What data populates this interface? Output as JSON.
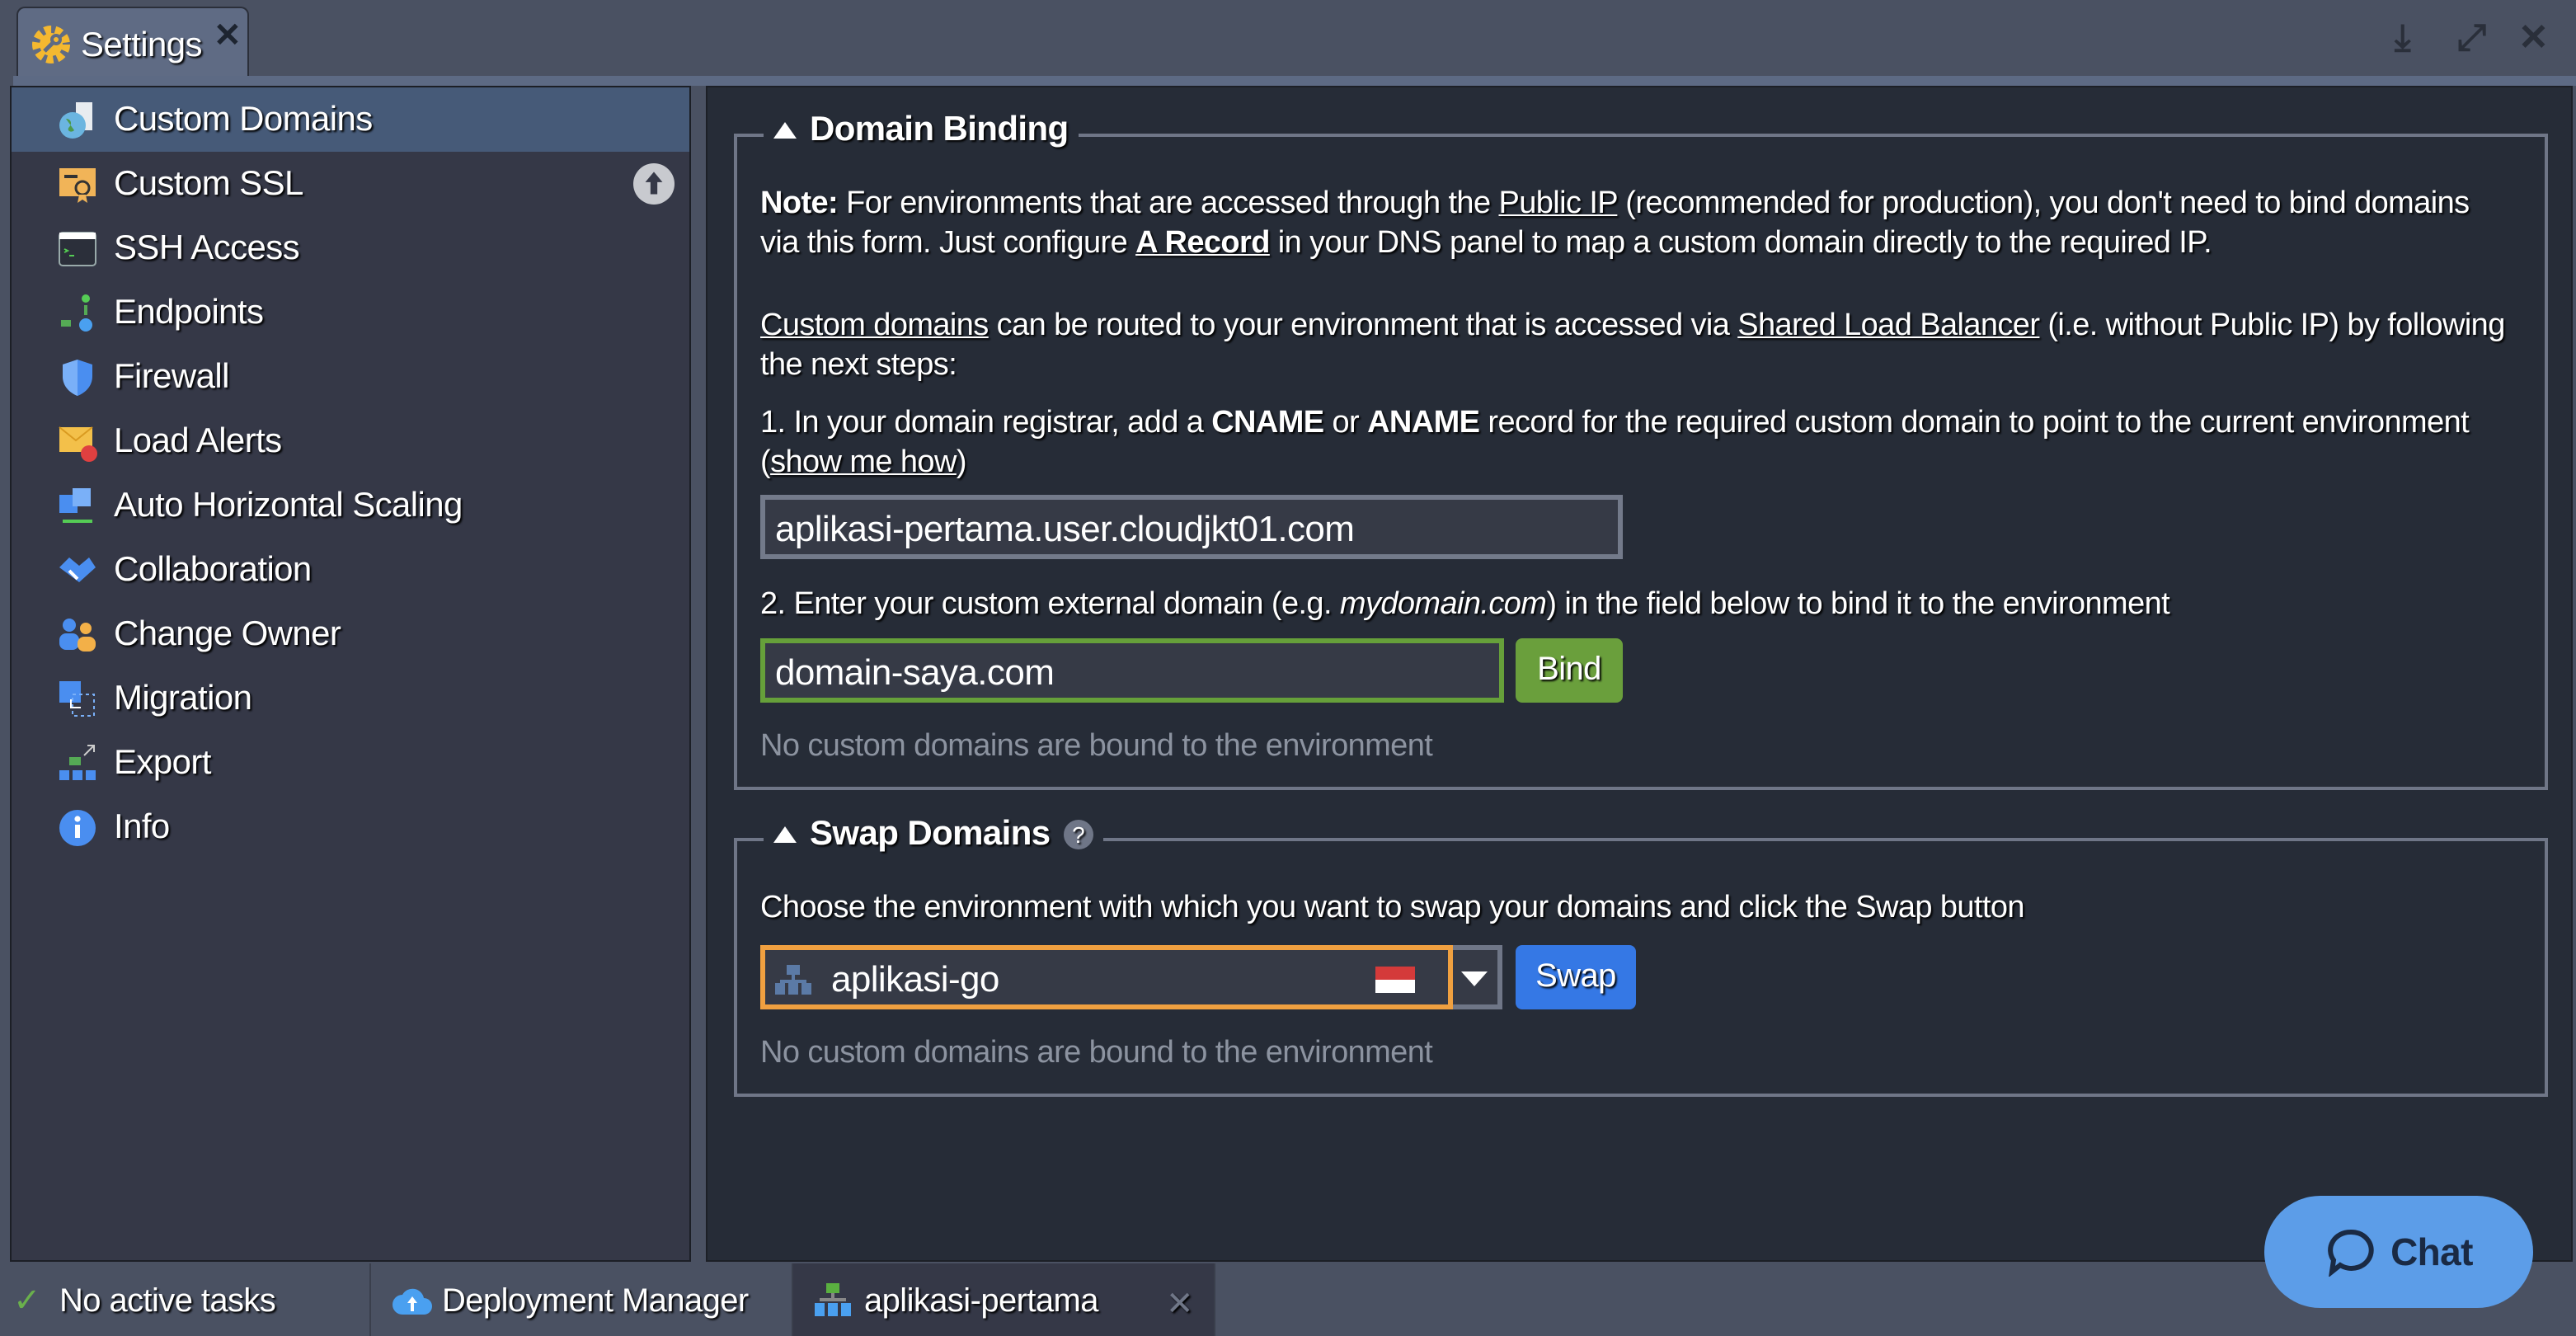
{
  "window": {
    "tab_title": "Settings",
    "tab_close": "✕",
    "actions": [
      "download-icon",
      "expand-icon",
      "close-icon"
    ]
  },
  "sidebar": {
    "items": [
      {
        "label": "Custom Domains",
        "icon": "globe-domain-icon",
        "selected": true
      },
      {
        "label": "Custom SSL",
        "icon": "certificate-icon"
      },
      {
        "label": "SSH Access",
        "icon": "terminal-icon"
      },
      {
        "label": "Endpoints",
        "icon": "endpoints-icon"
      },
      {
        "label": "Firewall",
        "icon": "shield-icon"
      },
      {
        "label": "Load Alerts",
        "icon": "alert-mail-icon"
      },
      {
        "label": "Auto Horizontal Scaling",
        "icon": "scaling-icon"
      },
      {
        "label": "Collaboration",
        "icon": "handshake-icon"
      },
      {
        "label": "Change Owner",
        "icon": "users-icon"
      },
      {
        "label": "Migration",
        "icon": "migration-icon"
      },
      {
        "label": "Export",
        "icon": "export-icon"
      },
      {
        "label": "Info",
        "icon": "info-icon"
      }
    ]
  },
  "binding": {
    "title": "Domain Binding",
    "note_label": "Note:",
    "note_1": " For environments that are accessed through the ",
    "public_ip": "Public IP",
    "note_2": " (recommended for production), you don't need to bind domains via this form. Just configure ",
    "a_record": "A Record",
    "note_3": " in your DNS panel to map a custom domain directly to the required IP.",
    "custom_domains": "Custom domains",
    "route_1": " can be routed to your environment that is accessed via ",
    "slb": "Shared Load Balancer",
    "route_2": " (i.e. without Public IP) by following the next steps:",
    "step1_a": "1. In your domain registrar, add a ",
    "cname": "CNAME",
    "or": " or ",
    "aname": "ANAME",
    "step1_b": " record for the required custom domain to point to the current environment (",
    "show_me": "show me how",
    "step1_c": ")",
    "env_domain": "aplikasi-pertama.user.cloudjkt01.com",
    "step2_a": "2. Enter your custom external domain (e.g. ",
    "example": "mydomain.com",
    "step2_b": ") in the field below to bind it to the environment",
    "domain_value": "domain-saya.com",
    "bind_label": "Bind",
    "empty": "No custom domains are bound to the environment"
  },
  "swap": {
    "title": "Swap Domains",
    "help": "?",
    "desc": "Choose the environment with which you want to swap your domains and click the Swap button",
    "selected_env": "aplikasi-go",
    "swap_label": "Swap",
    "empty": "No custom domains are bound to the environment"
  },
  "taskbar": {
    "tasks": "No active tasks",
    "deploy": "Deployment Manager",
    "env": "aplikasi-pertama",
    "close": "✕"
  },
  "chat": {
    "label": "Chat"
  },
  "colors": {
    "accent_green": "#6a9f3c",
    "accent_blue": "#3578e5",
    "select_border": "#f0a040",
    "chat": "#5c9de8"
  }
}
